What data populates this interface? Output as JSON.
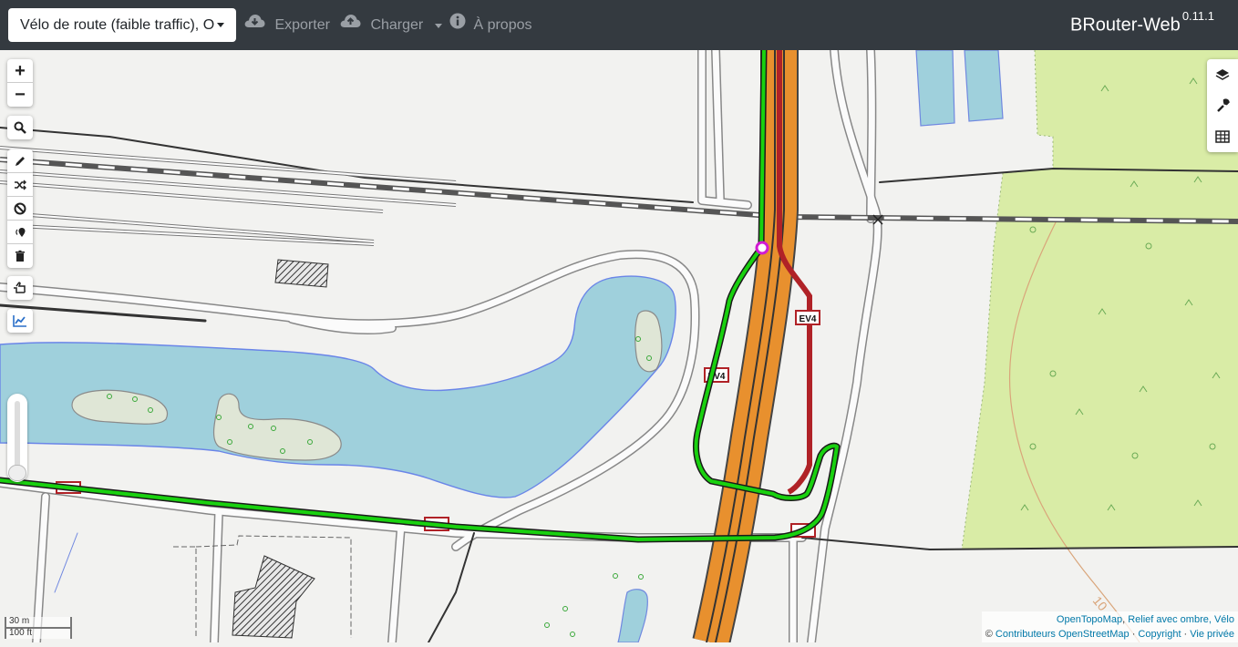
{
  "navbar": {
    "profile_select": "Vélo de route (faible traffic), O",
    "export_label": "Exporter",
    "load_label": "Charger",
    "about_label": "À propos",
    "brand": "BRouter-Web",
    "version": "0.11.1"
  },
  "map_controls": {
    "zoom_in": "+",
    "zoom_out": "−",
    "left_icons": [
      "search-icon",
      "pencil-icon",
      "shuffle-icon",
      "no-entry-icon",
      "beacon-icon",
      "trash-icon",
      "hand-pointer-icon",
      "chart-line-icon"
    ],
    "right_icons": [
      "layers-icon",
      "wrench-icon",
      "table-icon"
    ]
  },
  "map": {
    "route_labels": [
      "EV4",
      "EV4"
    ],
    "contour_label": "10",
    "colors": {
      "route": "#19d10f",
      "route_outline": "#1a1a1a",
      "motorway": "#e8902e",
      "cycle_route": "#b02227",
      "water": "#9fd0dc",
      "forest": "#d9eca6",
      "waypoint": "#d11ad1"
    }
  },
  "scale": {
    "metric": "30 m",
    "imperial": "100 ft"
  },
  "attribution": {
    "line1_link1": "OpenTopoMap",
    "line1_sep": ", ",
    "line1_link2": "Relief avec ombre",
    "line1_rest": ", Vélo",
    "line2_prefix": "© ",
    "line2_link1": "Contributeurs OpenStreetMap",
    "line2_sep1": " · ",
    "line2_link2": "Copyright",
    "line2_sep2": " · ",
    "line2_link3": "Vie privée"
  }
}
